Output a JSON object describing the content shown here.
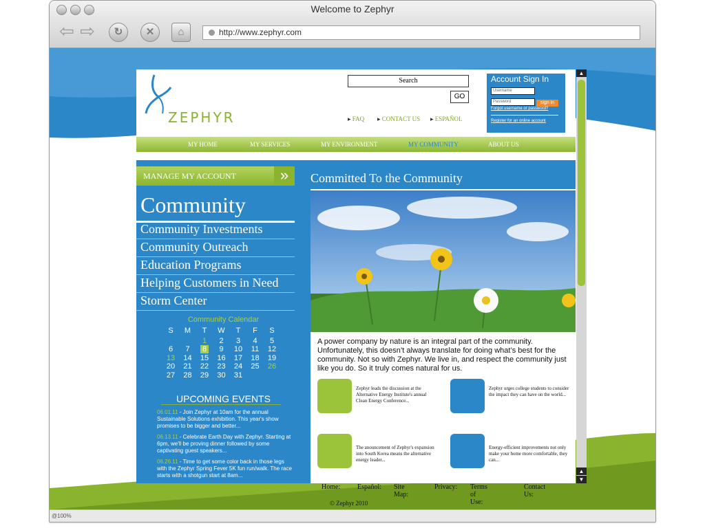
{
  "window": {
    "title": "Welcome to Zephyr",
    "url": "http://www.zephyr.com",
    "zoom": "@100%"
  },
  "site": {
    "brand": "ZEPHYR",
    "search_label": "Search",
    "go_label": "GO",
    "top_links": [
      "FAQ",
      "CONTACT US",
      "ESPAÑOL"
    ],
    "signin": {
      "title": "Account Sign In",
      "username_placeholder": "Username",
      "password_placeholder": "Password",
      "button": "sign in",
      "forgot": "Forgot username or password?",
      "register": "Register for an online account"
    },
    "nav": [
      "MY HOME",
      "MY SERVICES",
      "MY ENVIRONMENT",
      "MY COMMUNITY",
      "ABOUT US"
    ],
    "nav_active": "MY COMMUNITY",
    "manage": "MANAGE MY ACCOUNT",
    "section_title": "Community",
    "left_links": [
      "Community Investments",
      "Community Outreach",
      "Education Programs",
      "Helping Customers in Need",
      "Storm Center"
    ],
    "calendar": {
      "title": "Community Calendar",
      "weekdays": [
        "S",
        "M",
        "T",
        "W",
        "T",
        "F",
        "S"
      ],
      "weeks": [
        [
          "",
          "",
          "1",
          "2",
          "3",
          "4",
          "5"
        ],
        [
          "6",
          "7",
          "8",
          "9",
          "10",
          "11",
          "12"
        ],
        [
          "13",
          "14",
          "15",
          "16",
          "17",
          "18",
          "19"
        ],
        [
          "20",
          "21",
          "22",
          "23",
          "24",
          "25",
          "26"
        ],
        [
          "27",
          "28",
          "29",
          "30",
          "31",
          "",
          ""
        ]
      ],
      "highlight": "8",
      "green_days": [
        "1",
        "13",
        "26"
      ]
    },
    "events_title": "UPCOMING EVENTS",
    "events": [
      {
        "date": "06.01.11",
        "text": " - Join Zephyr at 10am for the annual Sustainable Solutions exhibition. This year's show promises to be bigger and better..."
      },
      {
        "date": "06.13.11",
        "text": " - Celebrate Earth Day with Zephyr. Starting at 6pm, we'll be proving dinner followed by some captivating guest speakers..."
      },
      {
        "date": "06.26.11",
        "text": " - Time to get some color back in those legs with the Zephyr Spring Fever 5K fun run/walk. The race starts with a shotgun start at 8am..."
      }
    ],
    "main_title": "Committed To the Community",
    "intro": "A power company by nature is an integral part of the community. Unfortunately, this doesn’t always translate for doing what’s best for the community. Not so with Zephyr. We live in, and respect the community just like you do. So it truly comes natural for us.",
    "cards": [
      "Zephyr leads the discussion at the Alternative Energy Institute's annual Clean Energy Conference...",
      "Zephyr urges college students to consider the impact they can have on the world...",
      "The anouncement of Zephyr's expansion into South Korea means the alternative energy leader...",
      "Energy-efficient improvements not only make your home more comfortable, they can..."
    ],
    "footer_links": [
      "Home",
      "Español",
      "Site Map",
      "Privacy",
      "Terms of Use",
      "Contact Us"
    ],
    "copyright": "© Zephyr 2010"
  }
}
